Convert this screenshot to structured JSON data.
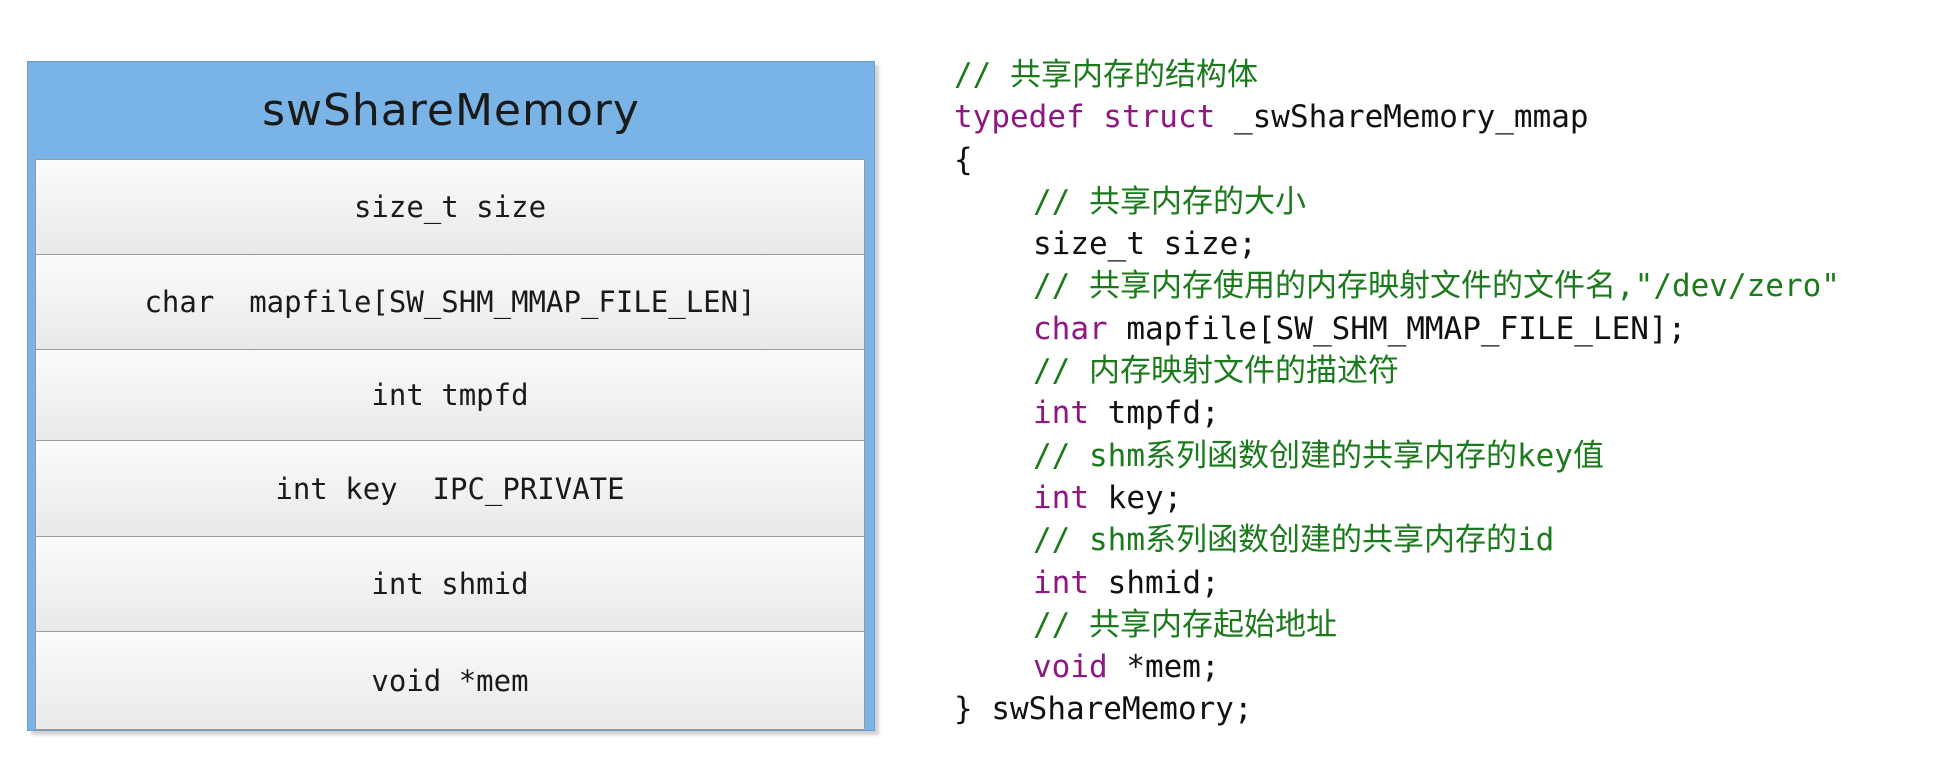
{
  "diagram": {
    "title": "swShareMemory",
    "fields": [
      "size_t size",
      "char  mapfile[SW_SHM_MMAP_FILE_LEN]",
      "int tmpfd",
      "int key  IPC_PRIVATE",
      "int shmid",
      "void *mem"
    ]
  },
  "code": {
    "comment_struct": "// 共享内存的结构体",
    "typedef_kw": "typedef struct",
    "struct_name": " _swShareMemory_mmap",
    "open_brace": "{",
    "comment_size": "// 共享内存的大小",
    "size_decl": "size_t size;",
    "comment_mapfile": "// 共享内存使用的内存映射文件的文件名,\"/dev/zero\"",
    "mapfile_type": "char",
    "mapfile_decl": " mapfile[SW_SHM_MMAP_FILE_LEN];",
    "comment_tmpfd": "// 内存映射文件的描述符",
    "tmpfd_type": "int",
    "tmpfd_decl": " tmpfd;",
    "comment_key": "// shm系列函数创建的共享内存的key值",
    "key_type": "int",
    "key_decl": " key;",
    "comment_shmid": "// shm系列函数创建的共享内存的id",
    "shmid_type": "int",
    "shmid_decl": " shmid;",
    "comment_mem": "// 共享内存起始地址",
    "mem_type": "void",
    "mem_decl": " *mem;",
    "close_line": "} swShareMemory;"
  },
  "colors": {
    "header_blue": "#7ab4e6",
    "comment_green": "#1b7a1b",
    "keyword_purple": "#8e1782"
  }
}
